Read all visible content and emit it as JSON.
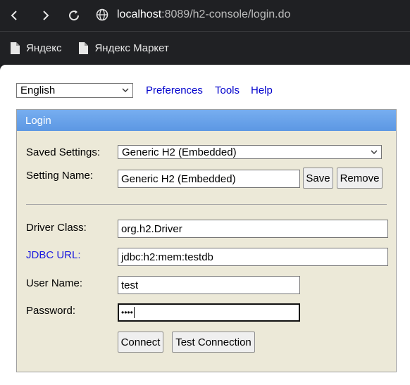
{
  "browser": {
    "url_host": "localhost",
    "url_rest": ":8089/h2-console/login.do",
    "icons": {
      "back": "back-arrow-icon",
      "forward": "forward-arrow-icon",
      "reload": "reload-icon",
      "site": "site-info-icon"
    },
    "bookmarks": [
      {
        "label": "Яндекс",
        "icon": "page-icon"
      },
      {
        "label": "Яндекс Маркет",
        "icon": "page-icon"
      }
    ]
  },
  "toolbar": {
    "language": "English",
    "links": [
      "Preferences",
      "Tools",
      "Help"
    ]
  },
  "login": {
    "header": "Login",
    "saved_settings_label": "Saved Settings:",
    "saved_settings_value": "Generic H2 (Embedded)",
    "setting_name_label": "Setting Name:",
    "setting_name_value": "Generic H2 (Embedded)",
    "save_label": "Save",
    "remove_label": "Remove",
    "driver_class_label": "Driver Class:",
    "driver_class_value": "org.h2.Driver",
    "jdbc_url_label": "JDBC URL:",
    "jdbc_url_value": "jdbc:h2:mem:testdb",
    "user_name_label": "User Name:",
    "user_name_value": "test",
    "password_label": "Password:",
    "password_masked": "••••",
    "connect_label": "Connect",
    "test_connection_label": "Test Connection"
  },
  "colors": {
    "panel_bg": "#ece9d8",
    "header_bg": "#6aa3ea",
    "link": "#0000cc"
  }
}
